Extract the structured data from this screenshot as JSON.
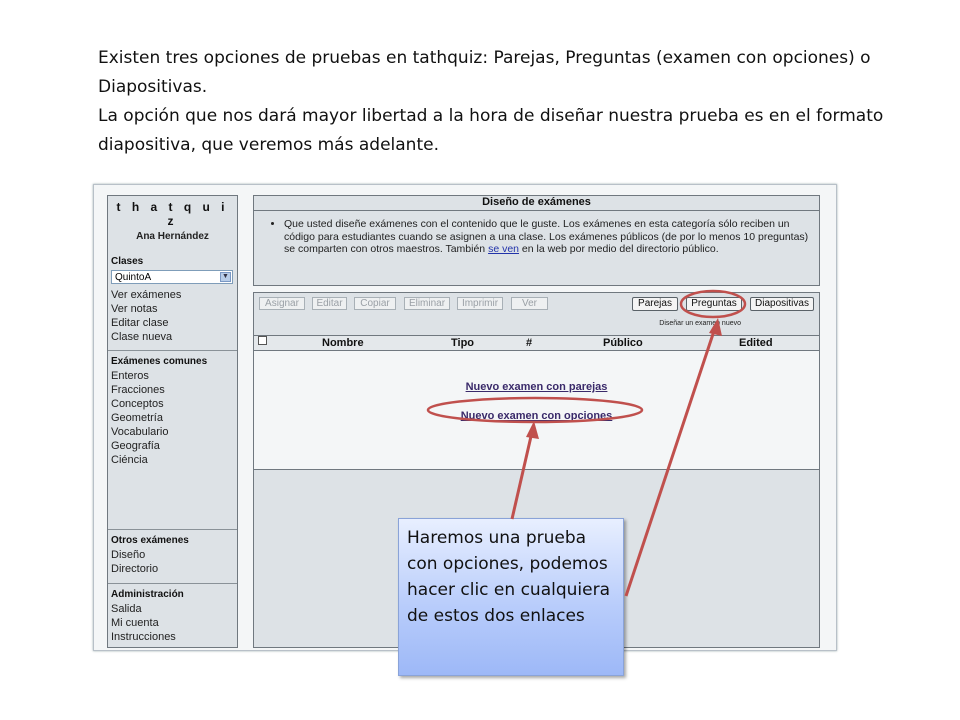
{
  "intro": {
    "line1": "Existen tres opciones de pruebas en tathquiz: Parejas, Preguntas (examen con opciones) o Diapositivas.",
    "line2": "La opción que nos dará mayor libertad a la hora de diseñar nuestra prueba es en el formato diapositiva, que veremos más adelante."
  },
  "app": {
    "brand": "t h a t q u i z",
    "user": "Ana Hernández",
    "sidebar": {
      "clases": {
        "title": "Clases",
        "selected_class": "QuintoA",
        "items": [
          "Ver exámenes",
          "Ver notas",
          "Editar clase",
          "Clase nueva"
        ]
      },
      "comunes": {
        "title": "Exámenes comunes",
        "items": [
          "Enteros",
          "Fracciones",
          "Conceptos",
          "Geometría",
          "Vocabulario",
          "Geografía",
          "Ciéncia"
        ]
      },
      "otros": {
        "title": "Otros exámenes",
        "items": [
          "Diseño",
          "Directorio"
        ]
      },
      "admin": {
        "title": "Administración",
        "items": [
          "Salida",
          "Mi cuenta",
          "Instrucciones"
        ]
      }
    },
    "info": {
      "title": "Diseño de exámenes",
      "text_before_link": "Que usted diseñe exámenes con el contenido que le guste. Los exámenes en esta categoría sólo reciben un código para estudiantes cuando se asignen a una clase. Los exámenes públicos (de por lo menos 10 preguntas) se comparten con otros maestros. También ",
      "link": "se ven",
      "text_after_link": " en la web por medio del directorio público."
    },
    "toolbar": {
      "actions": [
        "Asignar",
        "Editar",
        "Copiar",
        "Eliminar",
        "Imprimir",
        "Ver"
      ],
      "types": [
        "Parejas",
        "Preguntas",
        "Diapositivas"
      ],
      "caption": "Diseñar un examen nuevo"
    },
    "table": {
      "columns": [
        "Nombre",
        "Tipo",
        "#",
        "Público",
        "Edited"
      ],
      "new_links": [
        "Nuevo examen con parejas",
        "Nuevo examen con opciones"
      ]
    }
  },
  "callout": {
    "text": "Haremos una prueba con opciones, podemos hacer clic en cualquiera de estos dos enlaces"
  },
  "colors": {
    "annotation_red": "#c0504d",
    "callout_blue": "#b9cdfb",
    "panel_gray": "#dde2e6"
  }
}
